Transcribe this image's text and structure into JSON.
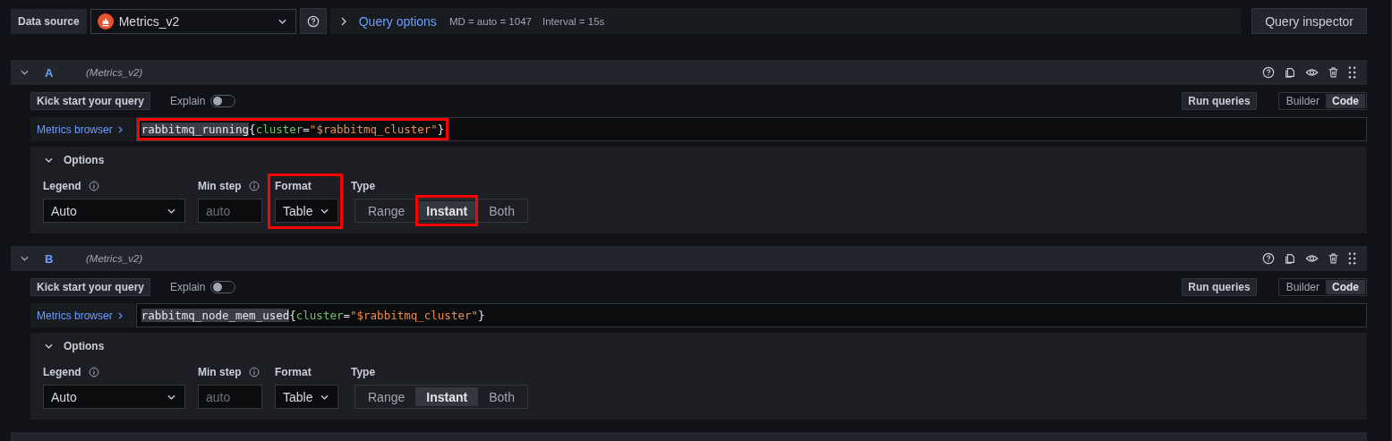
{
  "toolbar": {
    "datasource_label": "Data source",
    "datasource": "Metrics_v2",
    "query_options": "Query options",
    "md": "MD = auto = 1047",
    "interval": "Interval = 15s",
    "inspector": "Query inspector"
  },
  "queries": [
    {
      "ref": "A",
      "datasource": "(Metrics_v2)",
      "expanded": true,
      "kick_start": "Kick start your query",
      "explain_label": "Explain",
      "explain": false,
      "run": "Run queries",
      "modes": [
        {
          "label": "Builder",
          "selected": false
        },
        {
          "label": "Code",
          "selected": true
        }
      ],
      "metrics_browser": "Metrics browser",
      "expr_highlighted": true,
      "expr": [
        {
          "kind": "metric",
          "text": "rabbitmq_running"
        },
        {
          "kind": "punct",
          "text": "{"
        },
        {
          "kind": "label",
          "text": "cluster"
        },
        {
          "kind": "punct",
          "text": "="
        },
        {
          "kind": "string",
          "text": "\"$rabbitmq_cluster\""
        },
        {
          "kind": "punct",
          "text": "}"
        }
      ],
      "options": {
        "title": "Options",
        "expanded": true,
        "legend_label": "Legend",
        "legend": "Auto",
        "min_step_label": "Min step",
        "min_step_placeholder": "auto",
        "format_label": "Format",
        "format": "Table",
        "format_highlighted": true,
        "type_label": "Type",
        "types": [
          {
            "label": "Range",
            "selected": false,
            "highlighted": false
          },
          {
            "label": "Instant",
            "selected": true,
            "highlighted": true
          },
          {
            "label": "Both",
            "selected": false,
            "highlighted": false
          }
        ]
      }
    },
    {
      "ref": "B",
      "datasource": "(Metrics_v2)",
      "expanded": true,
      "kick_start": "Kick start your query",
      "explain_label": "Explain",
      "explain": false,
      "run": "Run queries",
      "modes": [
        {
          "label": "Builder",
          "selected": false
        },
        {
          "label": "Code",
          "selected": true
        }
      ],
      "metrics_browser": "Metrics browser",
      "expr_highlighted": false,
      "expr": [
        {
          "kind": "metric",
          "text": "rabbitmq_node_mem_used"
        },
        {
          "kind": "punct",
          "text": "{"
        },
        {
          "kind": "label",
          "text": "cluster"
        },
        {
          "kind": "punct",
          "text": "="
        },
        {
          "kind": "string",
          "text": "\"$rabbitmq_cluster\""
        },
        {
          "kind": "punct",
          "text": "}"
        }
      ],
      "options": {
        "title": "Options",
        "expanded": true,
        "legend_label": "Legend",
        "legend": "Auto",
        "min_step_label": "Min step",
        "min_step_placeholder": "auto",
        "format_label": "Format",
        "format": "Table",
        "format_highlighted": false,
        "type_label": "Type",
        "types": [
          {
            "label": "Range",
            "selected": false,
            "highlighted": false
          },
          {
            "label": "Instant",
            "selected": true,
            "highlighted": false
          },
          {
            "label": "Both",
            "selected": false,
            "highlighted": false
          }
        ]
      }
    }
  ]
}
